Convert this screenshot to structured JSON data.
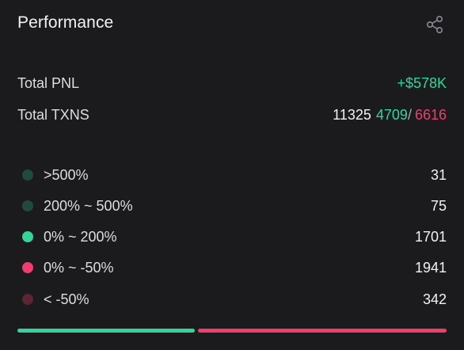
{
  "card": {
    "title": "Performance",
    "share_icon": "share-icon"
  },
  "summary": {
    "pnl_label": "Total PNL",
    "pnl_value": "+$578K",
    "txns_label": "Total TXNS",
    "txns_total": "11325",
    "txns_buys": "4709",
    "txns_separator": "/",
    "txns_sells": "6616"
  },
  "buckets": [
    {
      "label": ">500%",
      "count": "31",
      "color": "#1f4a3c"
    },
    {
      "label": "200% ~ 500%",
      "count": "75",
      "color": "#1f4a3c"
    },
    {
      "label": "0% ~ 200%",
      "count": "1701",
      "color": "#35d49a"
    },
    {
      "label": "0% ~ -50%",
      "count": "1941",
      "color": "#f03d6e"
    },
    {
      "label": "< -50%",
      "count": "342",
      "color": "#5a2535"
    }
  ],
  "ratio_bar": {
    "positive_fraction": 0.4156,
    "positive_color": "#35d49a",
    "negative_color": "#f03d6e"
  }
}
